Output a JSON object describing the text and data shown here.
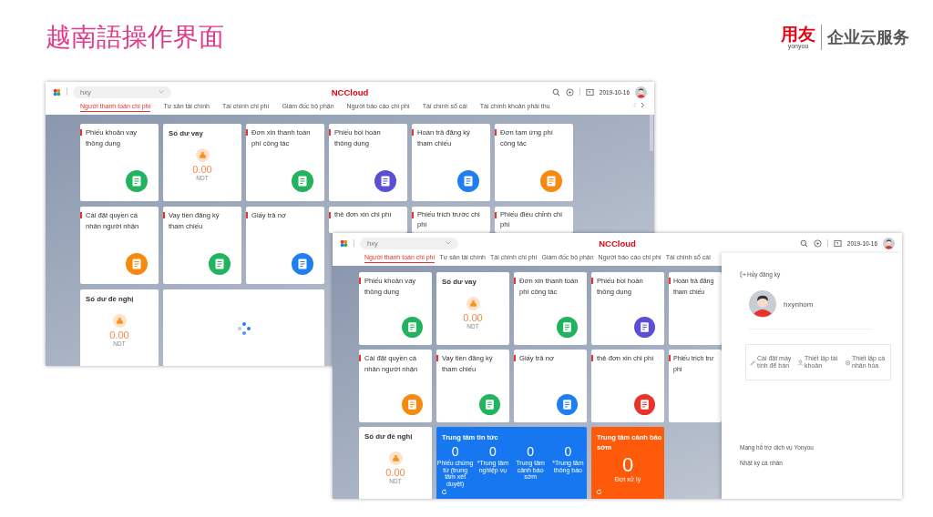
{
  "slide_title": "越南語操作界面",
  "brand": {
    "mark": "用友",
    "sub": "yonyou",
    "tagline": "企业云服务"
  },
  "windows": [
    {
      "search": {
        "value": "hxy"
      },
      "logo": "NCCloud",
      "date": "2019-10-16",
      "tab_arrows": true,
      "tabs": [
        {
          "label": "Người thanh toán chi phí",
          "selected": true
        },
        {
          "label": "Tư sản tài chính",
          "selected": false
        },
        {
          "label": "Tài chính chi phí",
          "selected": false
        },
        {
          "label": "Giám đốc bộ phận",
          "selected": false
        },
        {
          "label": "Người báo cáo chi phí",
          "selected": false
        },
        {
          "label": "Tài chính sổ cái",
          "selected": false
        },
        {
          "label": "Tài chính khoản phải thu",
          "selected": false
        }
      ],
      "tiles": [
        {
          "kind": "app",
          "lines": [
            "Phiếu khoản vay",
            "thông dụng"
          ],
          "color": "#22b35e"
        },
        {
          "kind": "balance",
          "title": "Số dư vay",
          "amount": "0.00",
          "currency": "NDT"
        },
        {
          "kind": "app",
          "lines": [
            "Đơn xin thanh toán",
            "phí công tác"
          ],
          "color": "#22b35e"
        },
        {
          "kind": "app",
          "lines": [
            "Phiếu bồi hoàn",
            "thông dụng"
          ],
          "color": "#5b4fd6"
        },
        {
          "kind": "app",
          "lines": [
            "Hoàn trả đăng ký",
            "tham chiếu"
          ],
          "color": "#1f7ef0"
        },
        {
          "kind": "app",
          "lines": [
            "Đơn tạm ứng phí",
            "công tác"
          ],
          "color": "#f7890f"
        },
        {
          "kind": "app",
          "lines": [
            "Cài đặt quyền cá",
            "nhân người nhận"
          ],
          "color": "#f7890f"
        },
        {
          "kind": "app",
          "lines": [
            "Vay tiền đăng ký",
            "tham chiếu"
          ],
          "color": "#22b35e"
        },
        {
          "kind": "app",
          "lines": [
            "Giấy trả nợ"
          ],
          "color": "#1f7ef0"
        },
        {
          "kind": "covered",
          "lines": [
            "thẻ đơn xin chi phí"
          ]
        },
        {
          "kind": "covered",
          "lines": [
            "Phiếu trích trước chi",
            "phí"
          ]
        },
        {
          "kind": "covered",
          "lines": [
            "Phiếu điều chỉnh chi",
            "phí"
          ]
        },
        {
          "kind": "balance",
          "title": "Số dư đề nghị",
          "amount": "0.00",
          "currency": "NDT"
        },
        {
          "kind": "loading"
        }
      ]
    },
    {
      "search": {
        "value": "hxy"
      },
      "logo": "NCCloud",
      "date": "2019-10-16",
      "tabs": [
        {
          "label": "Người thanh toán chi phí",
          "selected": true
        },
        {
          "label": "Tư sản tài chính",
          "selected": false
        },
        {
          "label": "Tài chính chi phí",
          "selected": false
        },
        {
          "label": "Giám đốc bộ phận",
          "selected": false
        },
        {
          "label": "Người báo cáo chi phí",
          "selected": false
        },
        {
          "label": "Tài chính sổ cái",
          "selected": false
        }
      ],
      "tiles": [
        {
          "kind": "app",
          "lines": [
            "Phiếu khoản vay",
            "thông dụng"
          ],
          "color": "#22b35e"
        },
        {
          "kind": "balance",
          "title": "Số dư vay",
          "amount": "0.00",
          "currency": "NDT"
        },
        {
          "kind": "app",
          "lines": [
            "Đơn xin thanh toán",
            "phí công tác"
          ],
          "color": "#22b35e"
        },
        {
          "kind": "app",
          "lines": [
            "Phiếu bồi hoàn",
            "thông dụng"
          ],
          "color": "#5b4fd6"
        },
        {
          "kind": "covered",
          "lines": [
            "Hoàn trả đăng",
            "tham chiếu"
          ]
        },
        {
          "kind": "app",
          "lines": [
            "Cài đặt quyền cá",
            "nhân người nhận"
          ],
          "color": "#f7890f"
        },
        {
          "kind": "app",
          "lines": [
            "Vay tiền đăng ký",
            "tham chiếu"
          ],
          "color": "#22b35e"
        },
        {
          "kind": "app",
          "lines": [
            "Giấy trả nợ"
          ],
          "color": "#1f7ef0"
        },
        {
          "kind": "app",
          "lines": [
            "thẻ đơn xin chi phí"
          ],
          "color": "#e8322a"
        },
        {
          "kind": "covered",
          "lines": [
            "Phiếu trích trư",
            "phí"
          ]
        },
        {
          "kind": "balance",
          "title": "Số dư đề nghị",
          "amount": "0.00",
          "currency": "NDT"
        },
        {
          "kind": "news",
          "title": "Trung tâm tin tức",
          "counters": [
            {
              "value": "0",
              "label": "Phiếu chứng từ (trung tâm xét duyệt)"
            },
            {
              "value": "0",
              "label": "*Trung tâm nghiệp vụ"
            },
            {
              "value": "0",
              "label": "Trung tâm cảnh báo sớm"
            },
            {
              "value": "0",
              "label": "*Trung tâm thông báo"
            }
          ]
        },
        {
          "kind": "alert",
          "title": "Trung tâm cảnh báo sớm",
          "value": "0",
          "label": "Đợi xử lý"
        }
      ],
      "panel": {
        "logout": "Hủy đăng ký",
        "user": "hxynhom",
        "shortcuts": [
          "Cài đặt máy tính để bàn",
          "Thiết lập tài khoản",
          "Thiết lập cá nhân hóa"
        ],
        "links": [
          "Mạng hỗ trợ dịch vụ Yonyou",
          "Nhật ký cá nhân"
        ]
      }
    }
  ]
}
